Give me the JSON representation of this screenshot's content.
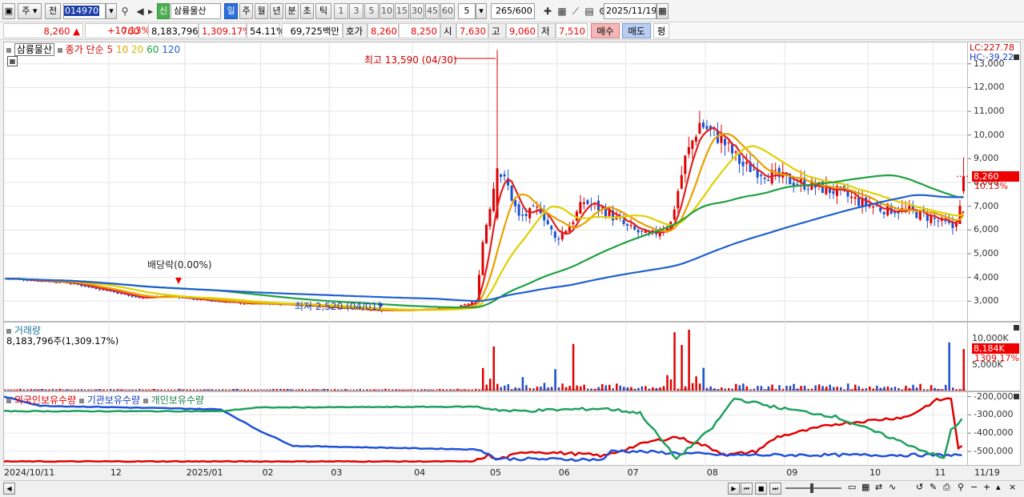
{
  "toolbar": {
    "period_type": "주",
    "prev": "전",
    "code": "014970",
    "stock_badge": "신",
    "stock_name": "삼륭물산",
    "tf_day": "일",
    "tf_week": "주",
    "tf_month": "월",
    "tf_year": "년",
    "tf_min": "분",
    "tf_sec": "초",
    "tf_tick": "틱",
    "intervals": [
      "1",
      "3",
      "5",
      "10",
      "15",
      "30",
      "45",
      "60"
    ],
    "interval_value": "5",
    "count": "265",
    "count_total": "/600",
    "date": "2025/11/19"
  },
  "quote": {
    "price": "8,260",
    "arrow": "▲",
    "change": "760",
    "change_pct": "+10.13%",
    "volume": "8,183,796",
    "volume_pct": "1,309.17%",
    "turnover": "54.11%",
    "amount": "69,725백만",
    "hoga_label": "호가",
    "hoga1": "8,260",
    "hoga2": "8,250",
    "open_label": "시",
    "open": "7,630",
    "high_label": "고",
    "high": "9,060",
    "low_label": "저",
    "low": "7,510",
    "buy": "매수",
    "sell": "매도",
    "eval": "평"
  },
  "legend": {
    "name": "삼륭물산",
    "ma_title": "종가 단순",
    "ma_periods": [
      "5",
      "10",
      "20",
      "60",
      "120"
    ],
    "ma_colors": [
      "#e02020",
      "#e8a000",
      "#e0d000",
      "#20a040",
      "#2060d0"
    ]
  },
  "axis_info": {
    "lc": "LC:227.78",
    "hc": "HC:-39.22"
  },
  "price_axis": [
    "13,000",
    "12,000",
    "11,000",
    "10,000",
    "9,000",
    "8,000",
    "7,000",
    "6,000",
    "5,000",
    "4,000",
    "3,000"
  ],
  "price_tag": {
    "value": "8,260",
    "pct": "10.13%"
  },
  "annotations": {
    "high": "최고 13,590 (04/30)",
    "low": "최저 2,520 (04/01)",
    "dividend": "배당락(0.00%)"
  },
  "volume": {
    "title": "거래량",
    "value": "8,183,796주(1,309.17%)",
    "axis": [
      "10,000K",
      "5,000K"
    ],
    "tag": "8,184K",
    "tag_pct": "1309.17%"
  },
  "holdings": {
    "foreign": "외국인보유수량",
    "institution": "기관보유수량",
    "individual": "개인보유수량",
    "axis": [
      "-200,000",
      "-300,000",
      "-400,000",
      "-500,000"
    ]
  },
  "x_labels": [
    "2024/10/11",
    "12",
    "2025/01",
    "02",
    "03",
    "04",
    "05",
    "06",
    "07",
    "08",
    "09",
    "10",
    "11",
    "11/19"
  ],
  "chart_data": {
    "type": "candlestick",
    "price_range": [
      2200,
      13800
    ],
    "price_ticks": [
      13000,
      12000,
      11000,
      10000,
      9000,
      8000,
      7000,
      6000,
      5000,
      4000,
      3000
    ],
    "high": {
      "value": 13590,
      "date": "04/30"
    },
    "low": {
      "value": 2520,
      "date": "04/01"
    },
    "last": {
      "close": 8260,
      "open": 7630,
      "high": 9060,
      "low": 7510,
      "change": 760,
      "change_pct": 10.13
    },
    "close_trend": [
      [
        0,
        3950
      ],
      [
        16,
        3800
      ],
      [
        28,
        3450
      ],
      [
        36,
        3150
      ],
      [
        46,
        3200
      ],
      [
        54,
        3050
      ],
      [
        66,
        2900
      ],
      [
        80,
        2850
      ],
      [
        90,
        2750
      ],
      [
        104,
        2600
      ],
      [
        114,
        2650
      ],
      [
        124,
        2700
      ],
      [
        130,
        3000
      ],
      [
        132,
        5500
      ],
      [
        136,
        8600
      ],
      [
        139,
        7800
      ],
      [
        142,
        6500
      ],
      [
        148,
        6900
      ],
      [
        152,
        5600
      ],
      [
        156,
        6200
      ],
      [
        160,
        7200
      ],
      [
        166,
        6800
      ],
      [
        172,
        6100
      ],
      [
        178,
        5700
      ],
      [
        184,
        6300
      ],
      [
        188,
        9000
      ],
      [
        192,
        10500
      ],
      [
        198,
        9800
      ],
      [
        204,
        8700
      ],
      [
        210,
        8400
      ],
      [
        216,
        8100
      ],
      [
        222,
        7900
      ],
      [
        230,
        7600
      ],
      [
        236,
        7200
      ],
      [
        242,
        6900
      ],
      [
        250,
        6800
      ],
      [
        256,
        6500
      ],
      [
        262,
        6100
      ],
      [
        266,
        7700
      ]
    ],
    "ma_periods": [
      5,
      10,
      20,
      60,
      120
    ],
    "volume_range": [
      0,
      12000000
    ],
    "volume_spikes": [
      [
        136,
        8700000
      ],
      [
        158,
        9200000
      ],
      [
        186,
        11500000
      ],
      [
        188,
        9000000
      ],
      [
        190,
        12000000
      ],
      [
        262,
        9500000
      ],
      [
        266,
        8183796
      ]
    ],
    "holdings": {
      "range": [
        -570000,
        -180000
      ],
      "ticks": [
        -200000,
        -300000,
        -400000,
        -500000
      ],
      "series": [
        "외국인보유수량",
        "기관보유수량",
        "개인보유수량"
      ],
      "foreign": [
        [
          0,
          -555000
        ],
        [
          130,
          -555000
        ],
        [
          134,
          -520000
        ],
        [
          136,
          -545000
        ],
        [
          145,
          -500000
        ],
        [
          160,
          -515000
        ],
        [
          166,
          -525000
        ],
        [
          178,
          -450000
        ],
        [
          186,
          -420000
        ],
        [
          194,
          -470000
        ],
        [
          200,
          -520000
        ],
        [
          208,
          -500000
        ],
        [
          214,
          -420000
        ],
        [
          230,
          -350000
        ],
        [
          250,
          -310000
        ],
        [
          258,
          -220000
        ],
        [
          262,
          -210000
        ],
        [
          264,
          -480000
        ],
        [
          266,
          -470000
        ]
      ],
      "institution": [
        [
          0,
          -200000
        ],
        [
          10,
          -250000
        ],
        [
          60,
          -270000
        ],
        [
          70,
          -380000
        ],
        [
          80,
          -470000
        ],
        [
          132,
          -490000
        ],
        [
          136,
          -540000
        ],
        [
          166,
          -545000
        ],
        [
          168,
          -495000
        ],
        [
          200,
          -520000
        ],
        [
          266,
          -520000
        ]
      ],
      "individual": [
        [
          0,
          -280000
        ],
        [
          60,
          -280000
        ],
        [
          70,
          -260000
        ],
        [
          130,
          -255000
        ],
        [
          140,
          -280000
        ],
        [
          166,
          -265000
        ],
        [
          176,
          -290000
        ],
        [
          186,
          -540000
        ],
        [
          196,
          -370000
        ],
        [
          202,
          -210000
        ],
        [
          214,
          -260000
        ],
        [
          230,
          -310000
        ],
        [
          246,
          -430000
        ],
        [
          260,
          -540000
        ],
        [
          262,
          -380000
        ],
        [
          266,
          -310000
        ]
      ]
    }
  }
}
